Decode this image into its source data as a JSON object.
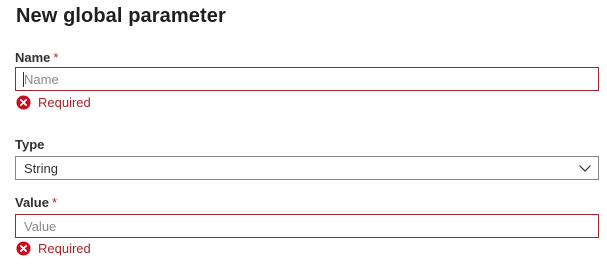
{
  "panel": {
    "title": "New global parameter"
  },
  "fields": {
    "name": {
      "label": "Name",
      "required_marker": "*",
      "placeholder": "Name",
      "error": "Required",
      "error_icon": "error-circle-icon"
    },
    "type": {
      "label": "Type",
      "selected": "String",
      "dropdown_icon": "chevron-down-icon"
    },
    "value": {
      "label": "Value",
      "required_marker": "*",
      "placeholder": "Value",
      "error": "Required",
      "error_icon": "error-circle-icon"
    }
  },
  "colors": {
    "error": "#a4262c",
    "text": "#323130",
    "placeholder": "#8a8886",
    "border": "#8a8886"
  }
}
